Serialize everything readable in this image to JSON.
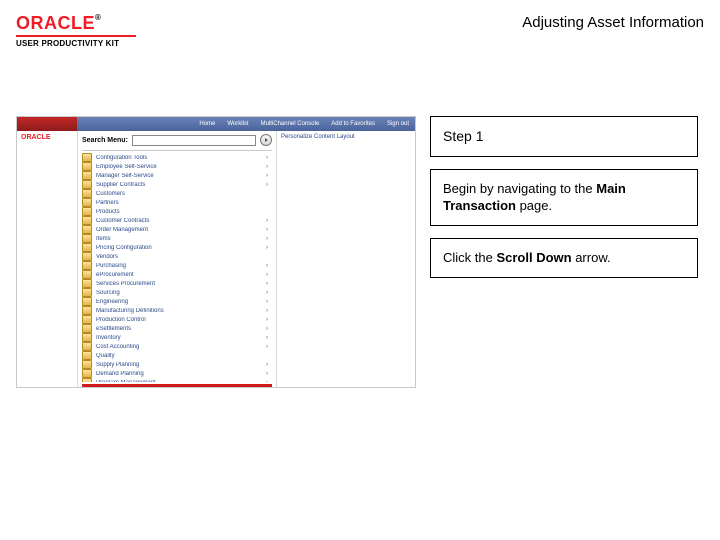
{
  "header": {
    "logo_word": "ORACLE",
    "logo_tm": "®",
    "logo_sub": "USER PRODUCTIVITY KIT",
    "title": "Adjusting Asset Information"
  },
  "shot": {
    "nav": [
      "Home",
      "Worklist",
      "MultiChannel Console",
      "Add to Favorites",
      "Sign out"
    ],
    "mini_logo": "ORACLE",
    "search_label": "Search Menu:",
    "right_panel_label": "Personalize Content   Layout",
    "menu": [
      {
        "label": "Configuration Tools",
        "sub": true
      },
      {
        "label": "Employee Self-Service",
        "sub": true
      },
      {
        "label": "Manager Self-Service",
        "sub": true
      },
      {
        "label": "Supplier Contracts",
        "sub": true
      },
      {
        "label": "Customers",
        "sub": false
      },
      {
        "label": "Partners",
        "sub": false
      },
      {
        "label": "Products",
        "sub": false
      },
      {
        "label": "Customer Contracts",
        "sub": true
      },
      {
        "label": "Order Management",
        "sub": true
      },
      {
        "label": "Items",
        "sub": true
      },
      {
        "label": "Pricing Configuration",
        "sub": true
      },
      {
        "label": "Vendors",
        "sub": false
      },
      {
        "label": "Purchasing",
        "sub": true
      },
      {
        "label": "eProcurement",
        "sub": true
      },
      {
        "label": "Services Procurement",
        "sub": true
      },
      {
        "label": "Sourcing",
        "sub": true
      },
      {
        "label": "Engineering",
        "sub": true
      },
      {
        "label": "Manufacturing Definitions",
        "sub": true
      },
      {
        "label": "Production Control",
        "sub": true
      },
      {
        "label": "eSettlements",
        "sub": true
      },
      {
        "label": "Inventory",
        "sub": true
      },
      {
        "label": "Cost Accounting",
        "sub": true
      },
      {
        "label": "Quality",
        "sub": false
      },
      {
        "label": "Supply Planning",
        "sub": true
      },
      {
        "label": "Demand Planning",
        "sub": true
      },
      {
        "label": "Program Management",
        "sub": true
      }
    ]
  },
  "instr": {
    "step": "Step 1",
    "l1_a": "Begin by navigating to the ",
    "l1_b": "Main Transaction",
    "l1_c": " page.",
    "l2_a": "Click the ",
    "l2_b": "Scroll Down",
    "l2_c": " arrow."
  }
}
